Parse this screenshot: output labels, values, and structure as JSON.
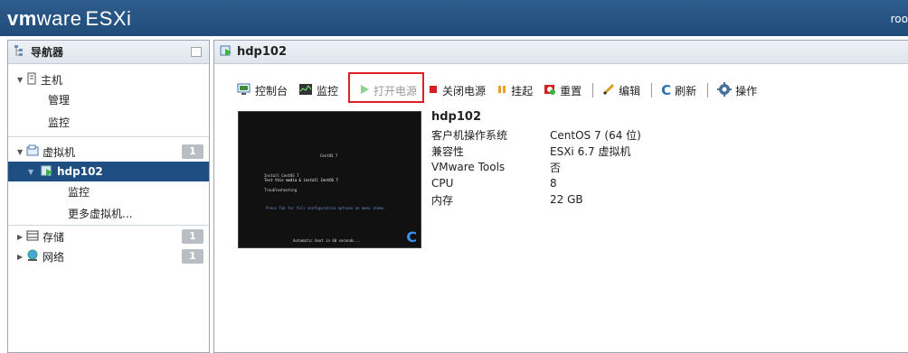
{
  "header": {
    "logo_vm": "vm",
    "logo_ware": "ware",
    "logo_esxi": "ESXi",
    "user": "roo"
  },
  "navigator": {
    "title": "导航器",
    "items": [
      {
        "label": "主机",
        "icon": "host-icon"
      },
      {
        "label": "管理"
      },
      {
        "label": "监控"
      },
      {
        "label": "虚拟机",
        "badge": "1",
        "icon": "vm-folder-icon"
      },
      {
        "label": "hdp102",
        "icon": "vm-running-icon"
      },
      {
        "label": "监控"
      },
      {
        "label": "更多虚拟机..."
      },
      {
        "label": "存储",
        "badge": "1",
        "icon": "storage-icon"
      },
      {
        "label": "网络",
        "badge": "1",
        "icon": "network-icon"
      }
    ]
  },
  "main": {
    "title": "hdp102",
    "toolbar": {
      "console": "控制台",
      "monitor": "监控",
      "power_on": "打开电源",
      "power_off": "关闭电源",
      "suspend": "挂起",
      "reset": "重置",
      "edit": "编辑",
      "refresh": "刷新",
      "actions": "操作"
    },
    "vm": {
      "name": "hdp102",
      "props": [
        {
          "key": "客户机操作系统",
          "value": "CentOS 7 (64 位)"
        },
        {
          "key": "兼容性",
          "value": "ESXi 6.7 虚拟机"
        },
        {
          "key": "VMware Tools",
          "value": "否"
        },
        {
          "key": "CPU",
          "value": "8"
        },
        {
          "key": "内存",
          "value": "22 GB"
        }
      ]
    },
    "console_screen": {
      "line1": "CentOS 7",
      "line2": "Install CentOS 7",
      "line3": "Test this media & install CentOS 7",
      "line4": "Troubleshooting",
      "line5": "Press Tab for full configuration options on menu items.",
      "line6": "Automatic boot in 60 seconds..."
    }
  },
  "colors": {
    "accent": "#1f4f82",
    "highlight": "#e02020"
  }
}
